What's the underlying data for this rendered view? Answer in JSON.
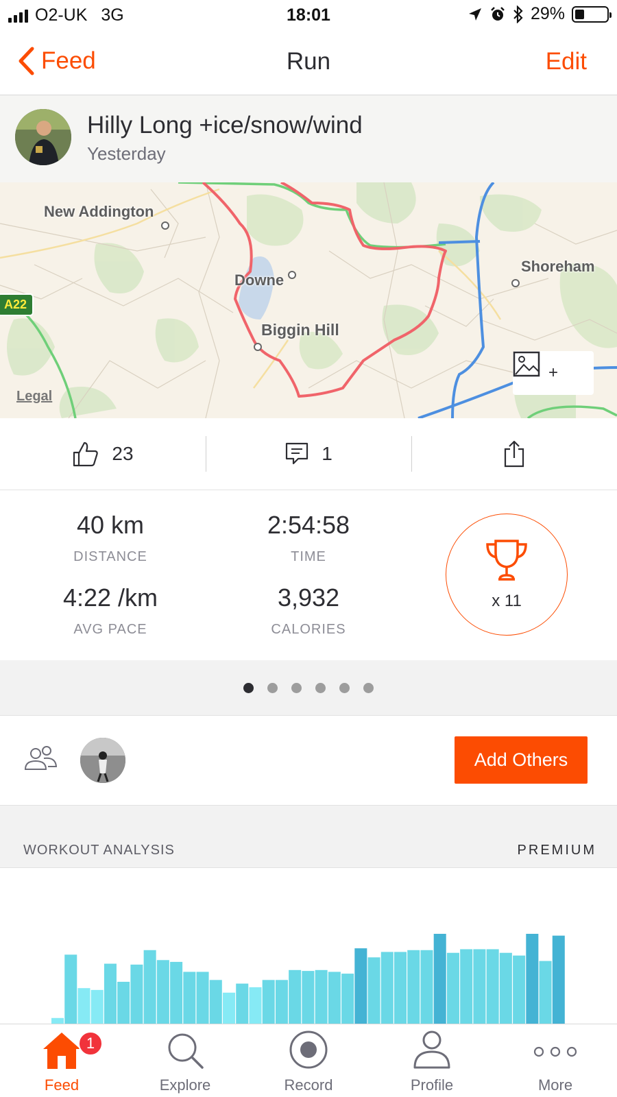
{
  "status_bar": {
    "carrier": "O2-UK",
    "network": "3G",
    "time": "18:01",
    "battery": "29%"
  },
  "nav": {
    "back_label": "Feed",
    "title": "Run",
    "edit_label": "Edit"
  },
  "activity": {
    "title": "Hilly Long +ice/snow/wind",
    "date": "Yesterday"
  },
  "map": {
    "labels": {
      "new_addington": "New Addington",
      "downe": "Downe",
      "biggin_hill": "Biggin Hill",
      "shoreham": "Shoreham"
    },
    "road_badge": "A22",
    "legal": "Legal",
    "add_photo_plus": "+"
  },
  "social": {
    "kudos_count": "23",
    "comment_count": "1"
  },
  "stats": {
    "distance_value": "40 km",
    "distance_label": "DISTANCE",
    "time_value": "2:54:58",
    "time_label": "TIME",
    "pace_value": "4:22 /km",
    "pace_label": "AVG PACE",
    "calories_value": "3,932",
    "calories_label": "CALORIES",
    "achievements": "x 11"
  },
  "pager": {
    "count": 6,
    "active_index": 0
  },
  "athletes": {
    "add_others_label": "Add Others"
  },
  "analysis": {
    "title": "WORKOUT ANALYSIS",
    "premium_label": "PREMIUM",
    "bars": [
      0.07,
      0.77,
      0.4,
      0.38,
      0.67,
      0.47,
      0.66,
      0.82,
      0.71,
      0.69,
      0.58,
      0.58,
      0.49,
      0.35,
      0.45,
      0.41,
      0.49,
      0.49,
      0.6,
      0.59,
      0.6,
      0.58,
      0.56,
      0.84,
      0.74,
      0.8,
      0.8,
      0.82,
      0.82,
      1.0,
      0.79,
      0.83,
      0.83,
      0.83,
      0.79,
      0.76,
      1.0,
      0.7,
      0.98
    ],
    "highlight_indices": [
      23,
      29,
      36,
      38
    ],
    "light_indices": [
      0,
      2,
      3,
      13,
      15
    ]
  },
  "tabbar": {
    "feed_label": "Feed",
    "feed_badge": "1",
    "explore_label": "Explore",
    "record_label": "Record",
    "profile_label": "Profile",
    "more_label": "More"
  },
  "colors": {
    "accent": "#fc4c02",
    "route": "#f05a5a",
    "bar": "#6ad8e6",
    "bar_light": "#86eaf5",
    "bar_dark": "#44b3d4"
  }
}
